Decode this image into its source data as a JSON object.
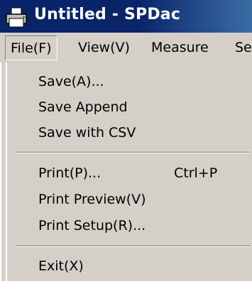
{
  "window": {
    "title": "Untitled - SPDac",
    "icon": "printer-icon"
  },
  "menubar": {
    "items": [
      {
        "label": "File(F)",
        "active": true
      },
      {
        "label": "View(V)"
      },
      {
        "label": "Measure"
      },
      {
        "label": "Se"
      }
    ]
  },
  "file_menu": {
    "items": [
      {
        "label": "Save(A)..."
      },
      {
        "label": "Save Append"
      },
      {
        "label": "Save with CSV"
      },
      {
        "label": "Print(P)...",
        "shortcut": "Ctrl+P"
      },
      {
        "label": "Print Preview(V)"
      },
      {
        "label": "Print Setup(R)..."
      },
      {
        "label": "Exit(X)"
      }
    ]
  },
  "colors": {
    "titlebar": "#0a246a",
    "face": "#d4d0c8",
    "highlight": "#ffffff",
    "shadow": "#808080"
  }
}
